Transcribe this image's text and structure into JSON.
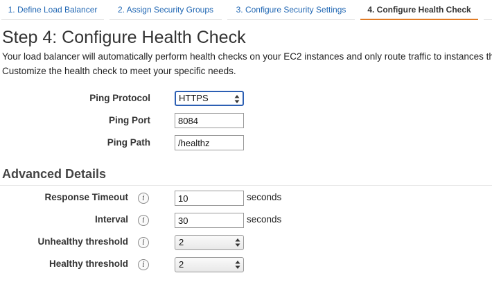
{
  "tabs": [
    {
      "label": "1. Define Load Balancer"
    },
    {
      "label": "2. Assign Security Groups"
    },
    {
      "label": "3. Configure Security Settings"
    },
    {
      "label": "4. Configure Health Check"
    },
    {
      "label": ""
    }
  ],
  "step": {
    "title": "Step 4: Configure Health Check",
    "description_line1": "Your load balancer will automatically perform health checks on your EC2 instances and only route traffic to instances that pass the health check.",
    "description_line2": "Customize the health check to meet your specific needs."
  },
  "ping": {
    "protocol_label": "Ping Protocol",
    "protocol_value": "HTTPS",
    "port_label": "Ping Port",
    "port_value": "8084",
    "path_label": "Ping Path",
    "path_value": "/healthz"
  },
  "advanced": {
    "title": "Advanced Details",
    "response_timeout_label": "Response Timeout",
    "response_timeout_value": "10",
    "response_timeout_unit": "seconds",
    "interval_label": "Interval",
    "interval_value": "30",
    "interval_unit": "seconds",
    "unhealthy_label": "Unhealthy threshold",
    "unhealthy_value": "2",
    "healthy_label": "Healthy threshold",
    "healthy_value": "2",
    "info_glyph": "i"
  },
  "colors": {
    "tab_link": "#1f66b3",
    "active_tab_underline": "#e07b25",
    "focus_border": "#2c5fb3"
  },
  "icons": {
    "info": "info-icon",
    "select_arrows": "updown-arrows-icon"
  }
}
